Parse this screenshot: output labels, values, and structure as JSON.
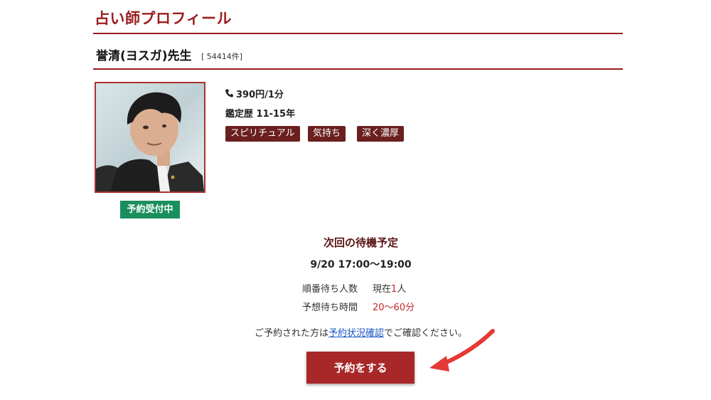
{
  "page": {
    "title": "占い師プロフィール"
  },
  "teacher": {
    "name": "誉清(ヨスガ)先生",
    "review_count": "[ 54414件]",
    "price": "390円/1分",
    "career": "鑑定歴 11-15年",
    "tags": [
      "スピリチュアル",
      "気持ち",
      "深く濃厚"
    ],
    "status": "予約受付中",
    "photo_alt": "誉清(ヨスガ)先生"
  },
  "schedule": {
    "heading": "次回の待機予定",
    "time": "9/20 17:00〜19:00",
    "queue_label": "順番待ち人数",
    "queue_prefix": "現在",
    "queue_count": "1",
    "queue_suffix": "人",
    "wait_label": "予想待ち時間",
    "wait_value": "20〜60分"
  },
  "note": {
    "before": "ご予約された方は",
    "link": "予約状況確認",
    "after": "でご確認ください。"
  },
  "actions": {
    "reserve_label": "予約をする"
  },
  "icons": {
    "price": "phone-icon",
    "annotation": "arrow-icon"
  },
  "colors": {
    "brand": "#9b1c1c",
    "tag": "#6b1f1f",
    "status": "#1a8f5e",
    "button": "#a8282a",
    "accent_red": "#c62828",
    "link": "#1a55c4",
    "arrow": "#e53935"
  }
}
